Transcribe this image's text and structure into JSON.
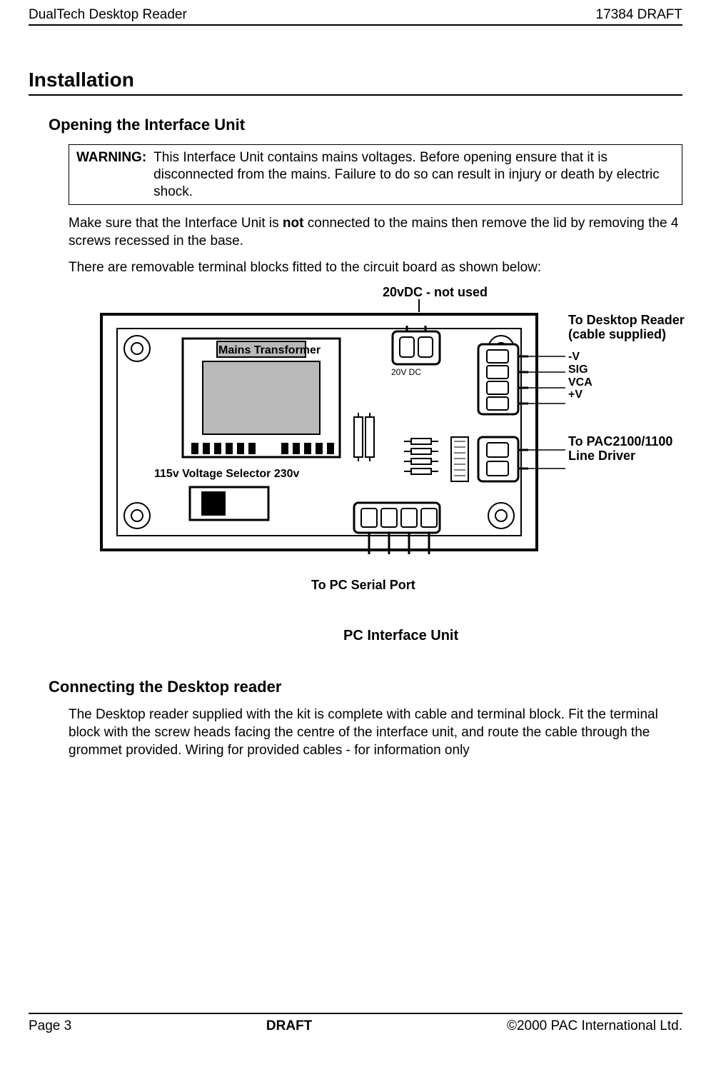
{
  "header": {
    "left": "DualTech Desktop Reader",
    "right": "17384 DRAFT"
  },
  "section_title": "Installation",
  "sub1": {
    "title": "Opening the Interface Unit",
    "warning_label": "WARNING:",
    "warning_text": "This Interface Unit contains mains voltages. Before opening ensure that it is disconnected from the mains. Failure to do so can result in injury or death by electric shock.",
    "para1_a": "Make sure that the Interface Unit is ",
    "para1_bold": "not",
    "para1_b": " connected to the mains then remove the lid by removing the 4 screws recessed in the base.",
    "para2": "There are removable terminal blocks fitted to the circuit board as shown below:"
  },
  "figure": {
    "top_label": "20vDC - not used",
    "top_block_label": "20V DC",
    "transformer": "Mains Transformer",
    "vsel_115": "115v",
    "vsel_mid": "Voltage Selector",
    "vsel_230": "230v",
    "right1_a": "To Desktop Reader",
    "right1_b": "(cable supplied)",
    "pins": {
      "p1": "-V",
      "p2": "SIG",
      "p3": "VCA",
      "p4": "+V"
    },
    "right2_a": "To PAC2100/1100",
    "right2_b": "Line Driver",
    "bottom_label": "To PC Serial Port",
    "caption": "PC  Interface Unit"
  },
  "sub2": {
    "title": "Connecting the Desktop reader",
    "para": "The Desktop reader supplied with the kit is complete with cable and terminal block. Fit the terminal block with the screw heads facing the centre of the interface unit, and route the cable through the grommet provided. Wiring for provided cables - for information only"
  },
  "footer": {
    "left": "Page 3",
    "center": "DRAFT",
    "right": "©2000 PAC International Ltd."
  }
}
